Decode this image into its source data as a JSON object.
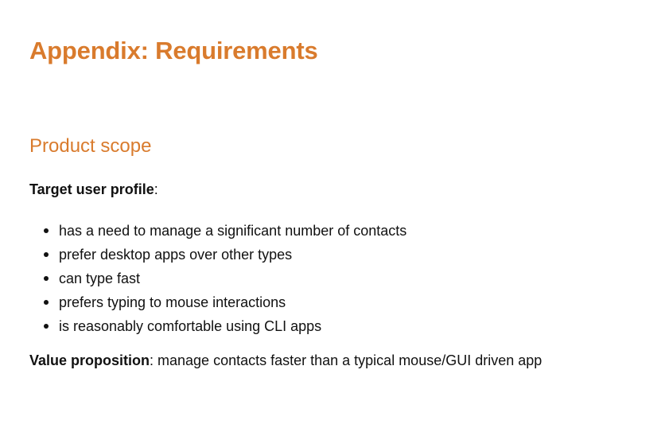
{
  "heading": "Appendix: Requirements",
  "section": {
    "title": "Product scope",
    "target_label": "Target user profile",
    "target_suffix": ":",
    "bullets": [
      "has a need to manage a significant number of contacts",
      "prefer desktop apps over other types",
      "can type fast",
      "prefers typing to mouse interactions",
      "is reasonably comfortable using CLI apps"
    ],
    "value_label": "Value proposition",
    "value_text": ": manage contacts faster than a typical mouse/GUI driven app"
  },
  "colors": {
    "heading": "#d97b2d",
    "text": "#111111"
  }
}
